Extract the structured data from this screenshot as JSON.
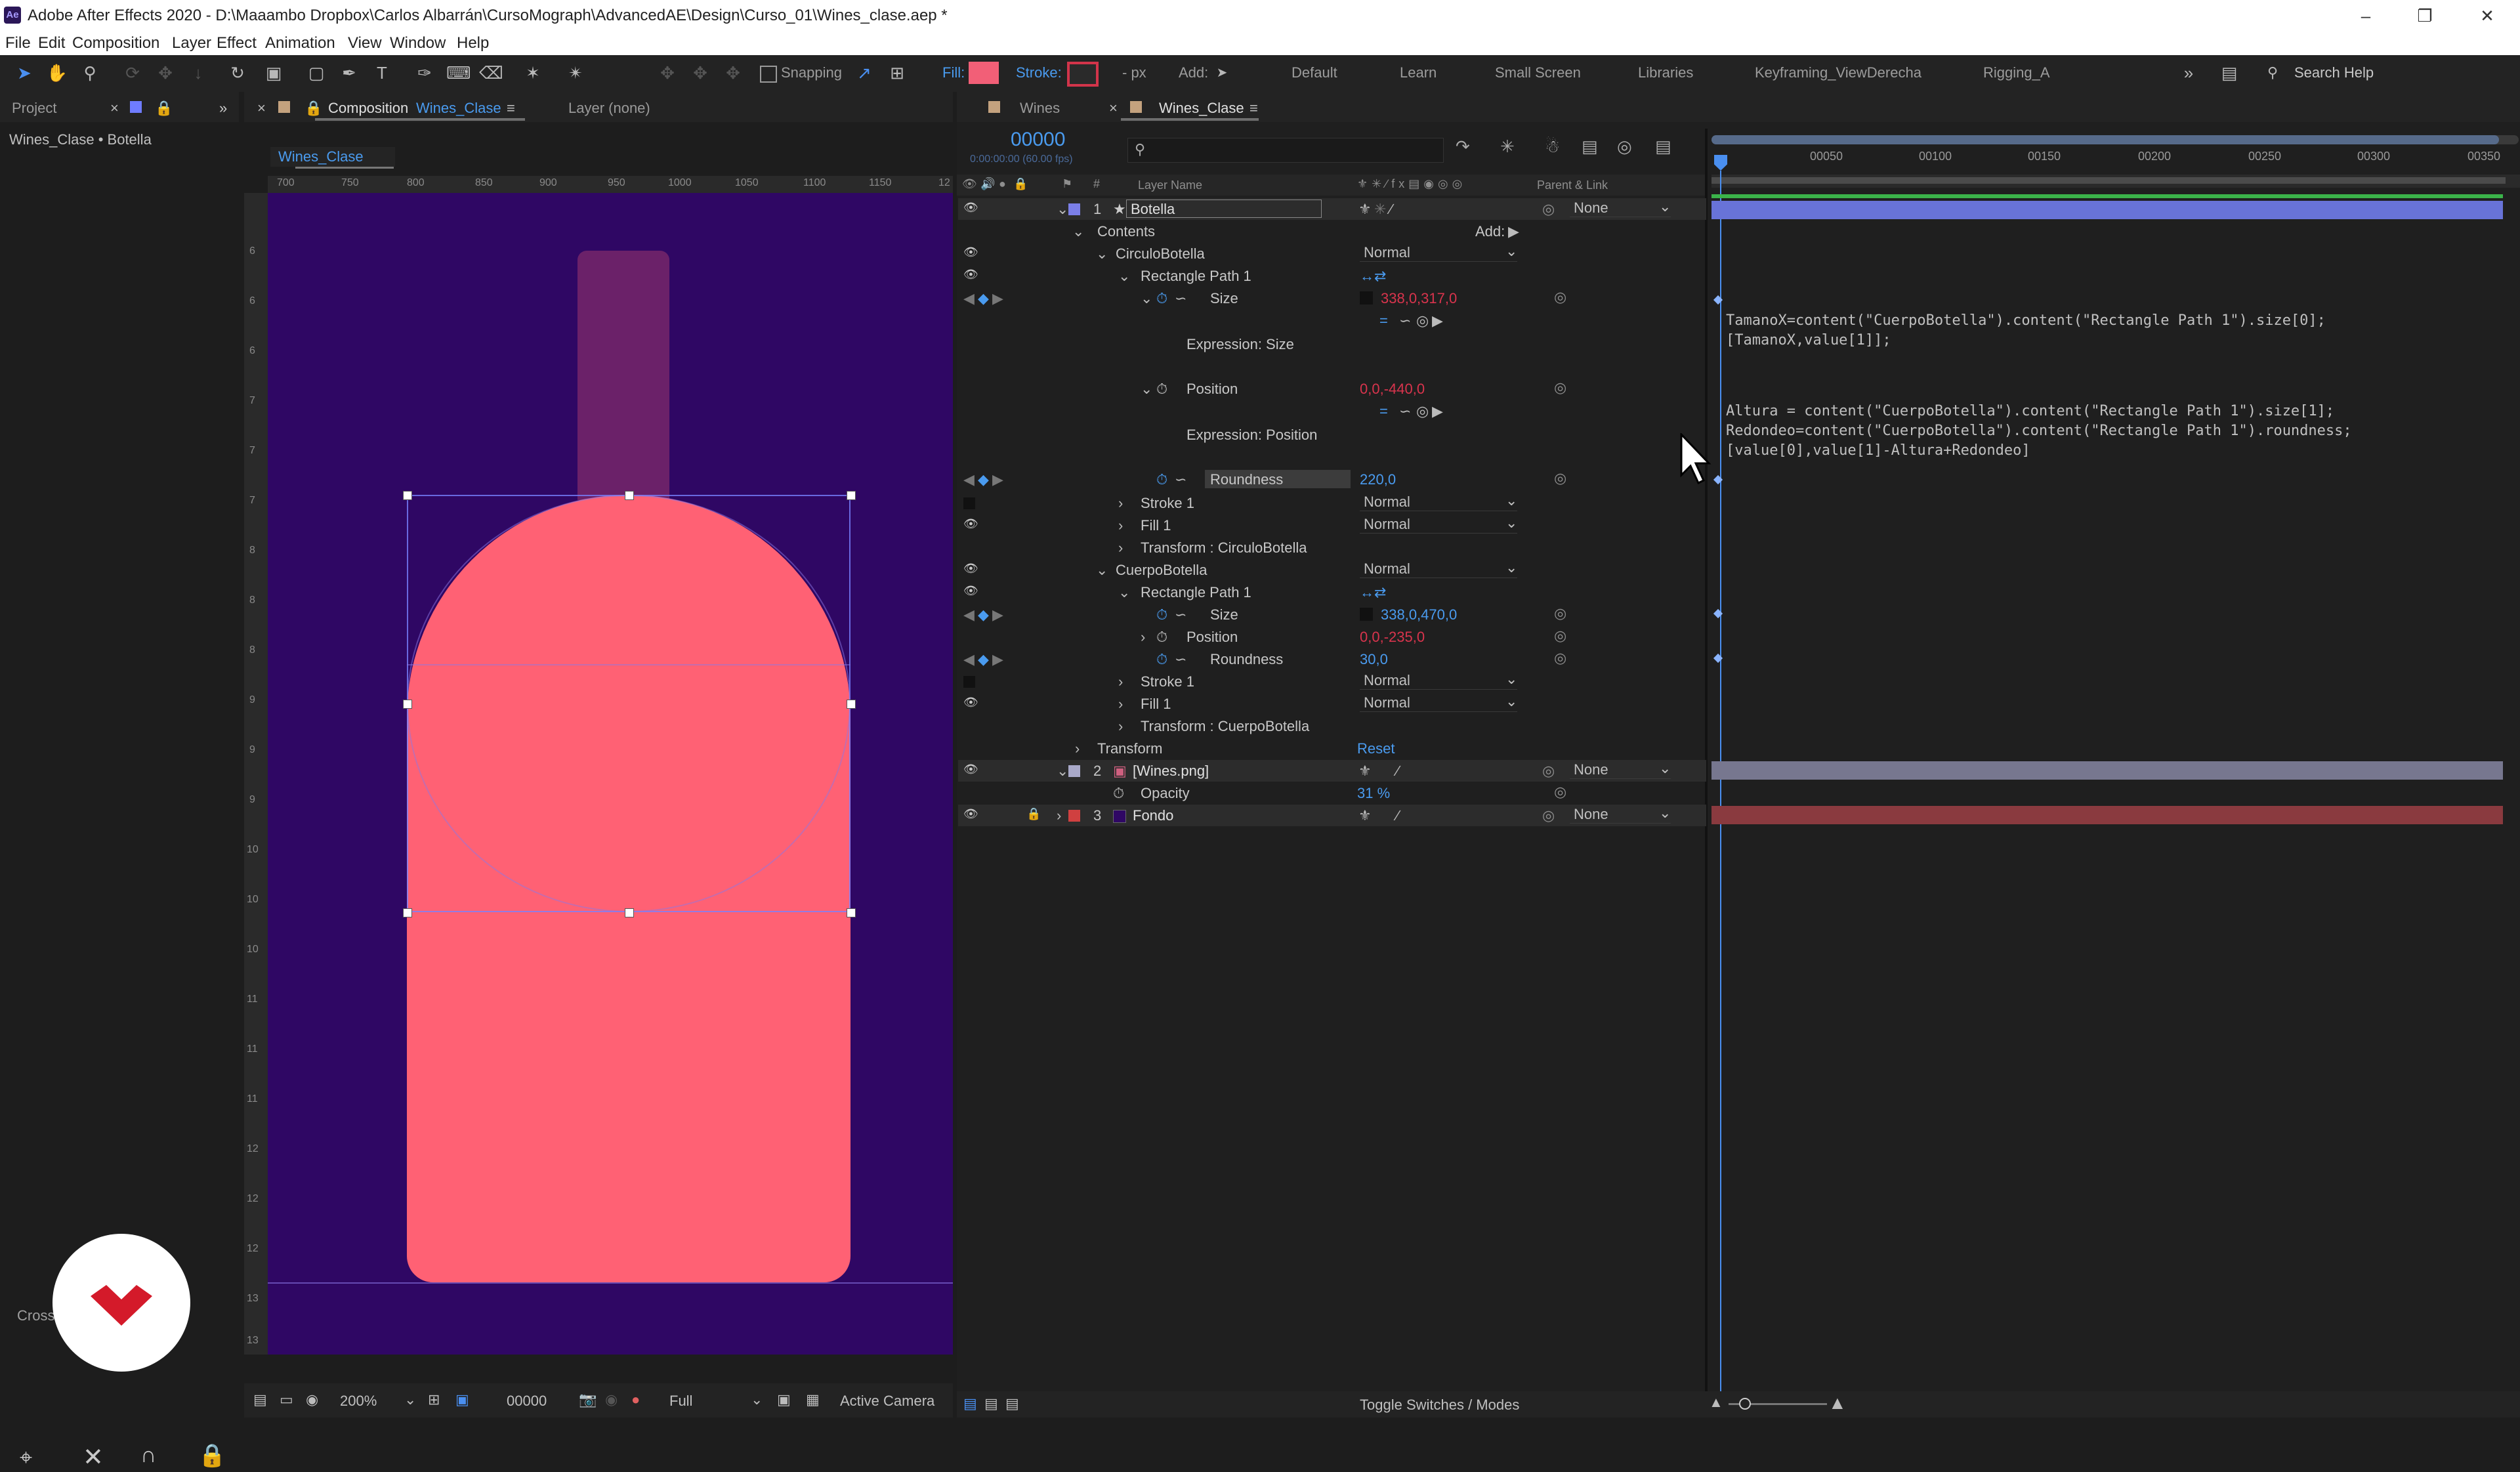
{
  "window": {
    "title": "Adobe After Effects 2020 - D:\\Maaambo Dropbox\\Carlos Albarrán\\CursoMograph\\AdvancedAE\\Design\\Curso_01\\Wines_clase.aep *",
    "app_icon": "Ae"
  },
  "menu": [
    "File",
    "Edit",
    "Composition",
    "Layer",
    "Effect",
    "Animation",
    "View",
    "Window",
    "Help"
  ],
  "toolbar": {
    "snapping": "Snapping",
    "fill_label": "Fill:",
    "stroke_label": "Stroke:",
    "stroke_unit": "- px",
    "add_label": "Add:",
    "workspaces": [
      "Default",
      "Learn",
      "Small Screen",
      "Libraries",
      "Keyframing_ViewDerecha",
      "Rigging_A"
    ],
    "search_placeholder": "Search Help",
    "fill_color": "#f25f77",
    "stroke_color": "#d2344a"
  },
  "project_panel": {
    "tab": "Project",
    "breadcrumb": "Wines_Clase • Botella",
    "bottom_label": "Crossh"
  },
  "comp_panel": {
    "tab_prefix": "Composition",
    "tab_name": "Wines_Clase",
    "layer_tab": "Layer (none)",
    "subtab": "Wines_Clase",
    "ruler_top": [
      "700",
      "750",
      "800",
      "850",
      "900",
      "950",
      "1000",
      "1050",
      "1100",
      "1150",
      "12"
    ],
    "ruler_left": [
      "6",
      "6",
      "6",
      "7",
      "7",
      "7",
      "8",
      "8",
      "8",
      "9",
      "9",
      "9",
      "10",
      "10",
      "10",
      "11",
      "11",
      "11",
      "12",
      "12",
      "12",
      "13",
      "13"
    ],
    "zoom": "200%",
    "timecode": "00000",
    "resolution": "Full",
    "camera": "Active Camera",
    "background": "#2f0764",
    "bottle_color": "#ff6174",
    "neck_color": "#6b2169"
  },
  "timeline": {
    "tabs": [
      "Wines",
      "Wines_Clase"
    ],
    "timecode": "00000",
    "fps": "0:00:00:00 (60.00 fps)",
    "columns": {
      "layer_name": "Layer Name",
      "parent": "Parent & Link"
    },
    "ruler": [
      "00050",
      "00100",
      "00150",
      "00200",
      "00250",
      "00300",
      "00350"
    ],
    "rows": {
      "l1_num": "1",
      "l1_name": "Botella",
      "l1_parent": "None",
      "contents": "Contents",
      "add": "Add:",
      "circulo": "CirculoBotella",
      "circulo_mode": "Normal",
      "rect1": "Rectangle Path 1",
      "size": "Size",
      "size_val": "338,0,317,0",
      "expr_size": "Expression: Size",
      "position": "Position",
      "position_val": "0,0,-440,0",
      "expr_pos": "Expression: Position",
      "roundness": "Roundness",
      "roundness_val": "220,0",
      "stroke1": "Stroke 1",
      "stroke1_mode": "Normal",
      "fill1": "Fill 1",
      "fill1_mode": "Normal",
      "transform_circulo": "Transform : CirculoBotella",
      "cuerpo": "CuerpoBotella",
      "cuerpo_mode": "Normal",
      "rect2": "Rectangle Path 1",
      "size2": "Size",
      "size2_val": "338,0,470,0",
      "position2": "Position",
      "position2_val": "0,0,-235,0",
      "roundness2": "Roundness",
      "roundness2_val": "30,0",
      "stroke2": "Stroke 1",
      "stroke2_mode": "Normal",
      "fill2": "Fill 1",
      "fill2_mode": "Normal",
      "transform_cuerpo": "Transform : CuerpoBotella",
      "transform": "Transform",
      "reset": "Reset",
      "l2_num": "2",
      "l2_name": "[Wines.png]",
      "l2_parent": "None",
      "opacity": "Opacity",
      "opacity_val": "31 %",
      "l3_num": "3",
      "l3_name": "Fondo",
      "l3_parent": "None"
    },
    "expression_size": "TamanoX=content(\"CuerpoBotella\").content(\"Rectangle Path 1\").size[0];\n[TamanoX,value[1]];",
    "expression_position": "Altura = content(\"CuerpoBotella\").content(\"Rectangle Path 1\").size[1];\nRedondeo=content(\"CuerpoBotella\").content(\"Rectangle Path 1\").roundness;\n[value[0],value[1]-Altura+Redondeo]",
    "toggle_label": "Toggle Switches / Modes",
    "label_colors": {
      "l1": "#7b7fe8",
      "l2": "#a9a9c9",
      "l3": "#d04040"
    },
    "bar_colors": {
      "l1": "#6873d8",
      "l2": "#77778f",
      "l3": "#8a3a3f"
    }
  }
}
